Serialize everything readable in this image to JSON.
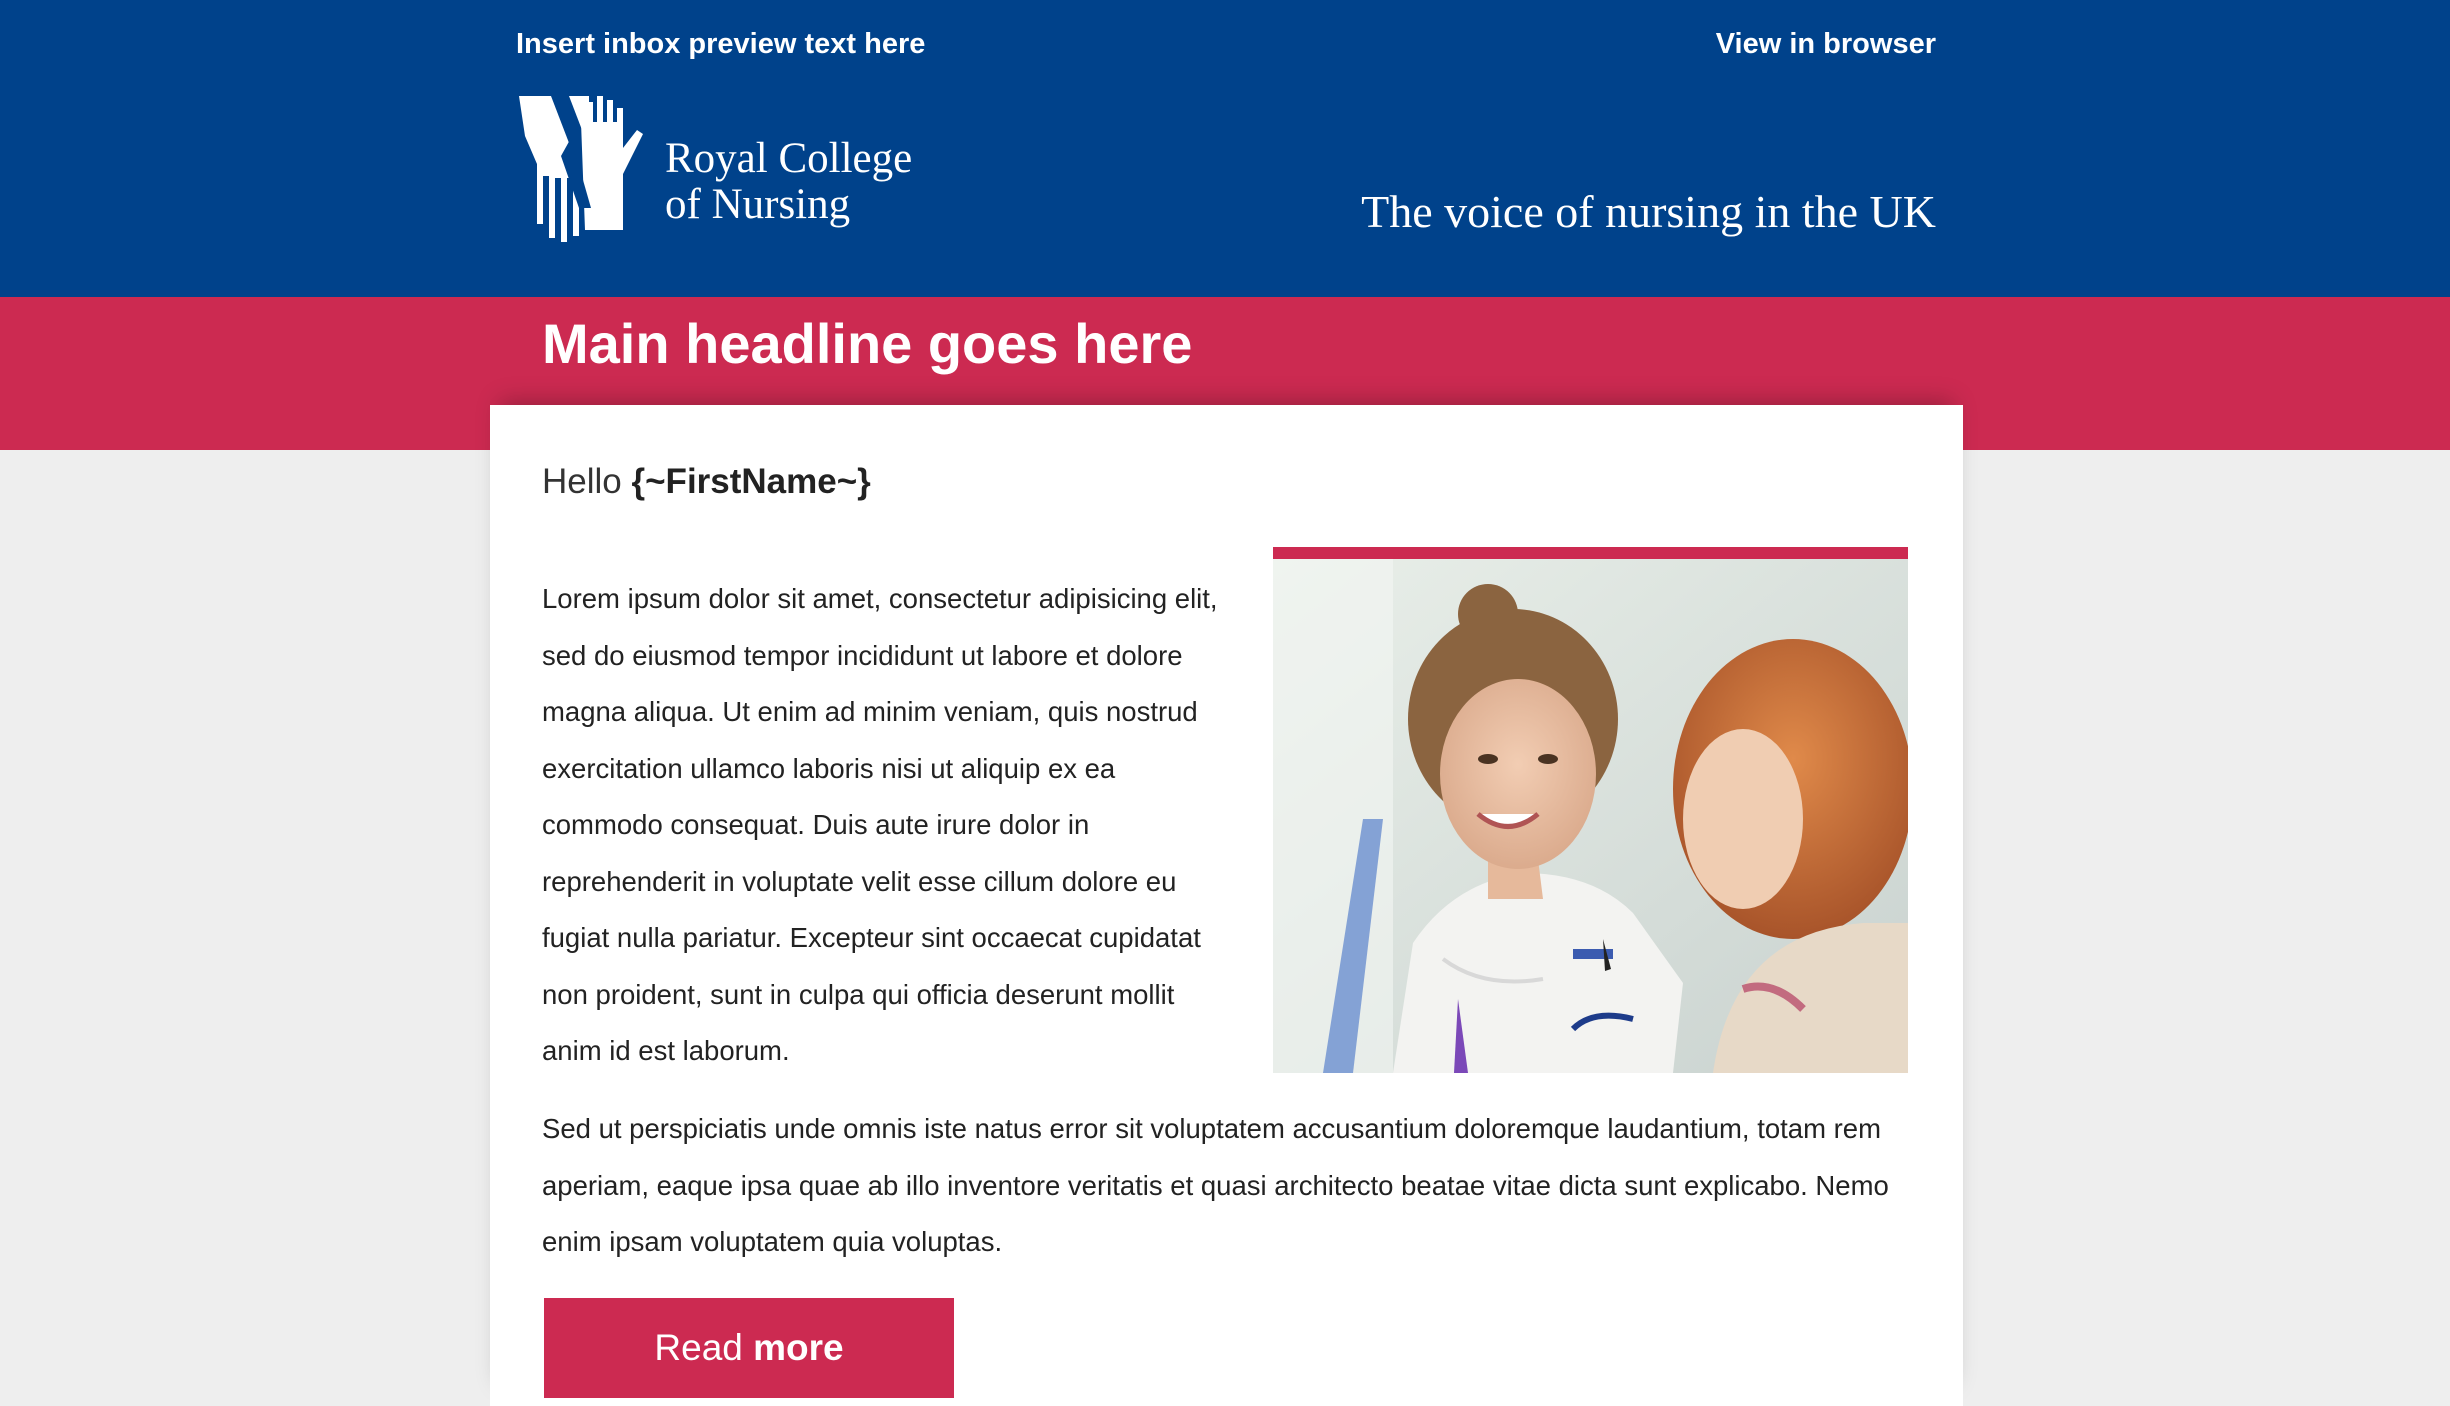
{
  "header": {
    "preview_text": "Insert inbox preview text here",
    "view_in_browser": "View in browser",
    "logo_line1": "Royal College",
    "logo_line2": "of Nursing",
    "tagline": "The voice of nursing in the UK"
  },
  "banner": {
    "headline": "Main headline goes here"
  },
  "body": {
    "greeting_prefix": "Hello",
    "greeting_name": "{~FirstName~}",
    "paragraph1": "Lorem ipsum dolor sit amet, consectetur adipisicing elit, sed do eiusmod tempor incididunt ut labore et dolore magna aliqua. Ut enim ad minim veniam, quis nostrud exercitation ullamco laboris nisi ut aliquip ex ea commodo consequat. Duis aute irure dolor in reprehenderit in voluptate velit esse cillum dolore eu fugiat nulla pariatur. Excepteur sint occaecat cupidatat non proident, sunt in culpa qui officia deserunt mollit anim id est laborum.",
    "paragraph2": "Sed ut perspiciatis unde omnis iste natus error sit voluptatem accusantium doloremque laudantium, totam rem aperiam, eaque ipsa quae ab illo inventore veritatis et quasi architecto beatae vitae dicta sunt explicabo. Nemo enim ipsam voluptatem quia voluptas.",
    "cta_regular": "Read",
    "cta_bold": "more"
  },
  "colors": {
    "brand_blue": "#00428b",
    "brand_red": "#cc2a51",
    "background": "#eeeeee"
  },
  "icons": {
    "logo": "rcn-hands-logo"
  }
}
